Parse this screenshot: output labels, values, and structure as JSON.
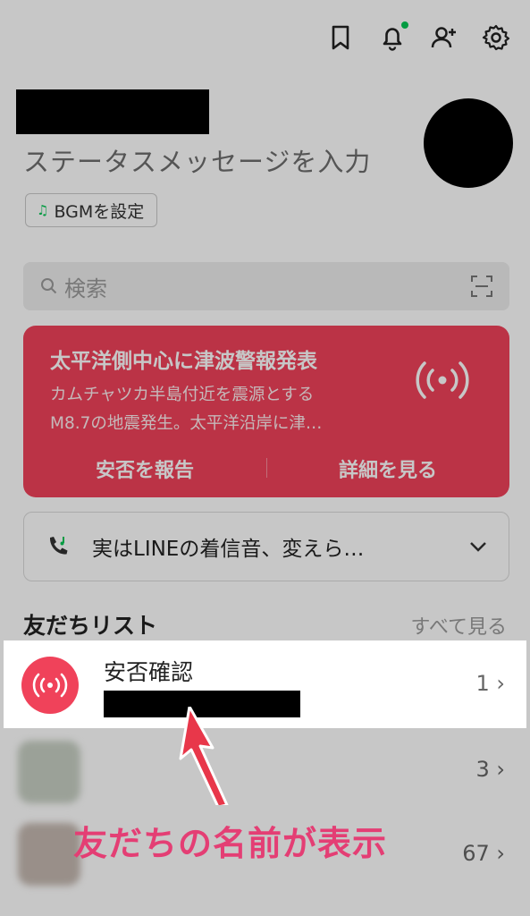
{
  "header": {
    "icons": [
      "bookmark-icon",
      "bell-icon",
      "add-friend-icon",
      "settings-icon"
    ],
    "notification_dot_color": "#06c755"
  },
  "profile": {
    "status_placeholder": "ステータスメッセージを入力",
    "bgm_label": "BGMを設定"
  },
  "search": {
    "placeholder": "検索"
  },
  "alert": {
    "title": "太平洋側中心に津波警報発表",
    "body_line1": "カムチャツカ半島付近を震源とする",
    "body_line2": "M8.7の地震発生。太平洋沿岸に津…",
    "action_report": "安否を報告",
    "action_details": "詳細を見る",
    "color": "#f0425a"
  },
  "ringtone_banner": {
    "text": "実はLINEの着信音、変えら…"
  },
  "friends": {
    "header": "友だちリスト",
    "see_all": "すべて見る",
    "rows": [
      {
        "title": "安否確認",
        "count": "1"
      },
      {
        "count": "3"
      },
      {
        "count": "67"
      }
    ]
  },
  "annotation": {
    "caption": "友だちの名前が表示",
    "color": "#e43e74"
  }
}
